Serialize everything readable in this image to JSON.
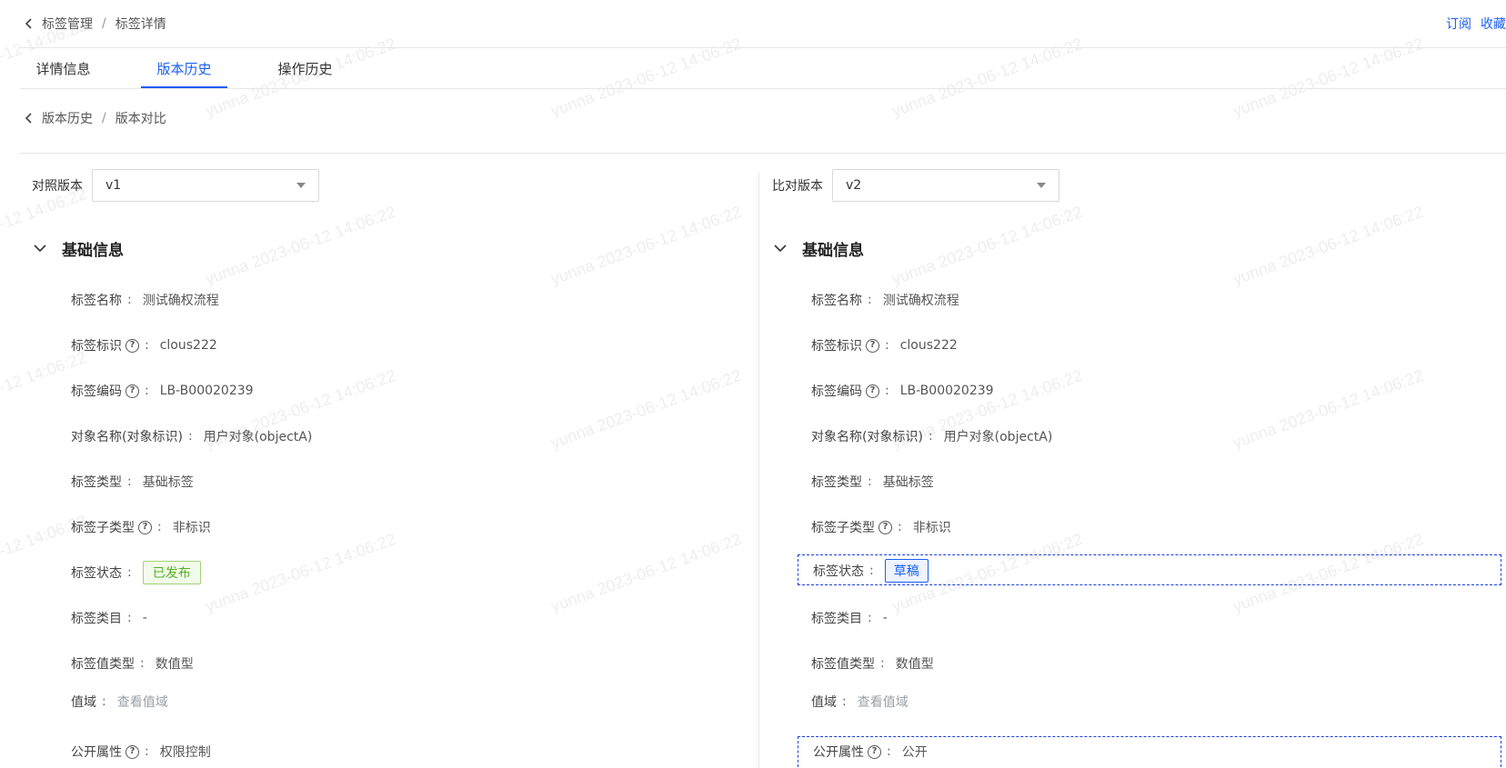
{
  "watermark": "yunna 2023-06-12 14:06:22",
  "header": {
    "breadcrumb": [
      "标签管理",
      "标签详情"
    ],
    "actions": [
      "订阅",
      "收藏"
    ]
  },
  "tabs": [
    {
      "label": "详情信息",
      "active": false
    },
    {
      "label": "版本历史",
      "active": true
    },
    {
      "label": "操作历史",
      "active": false
    }
  ],
  "subcrumb": [
    "版本历史",
    "版本对比"
  ],
  "left": {
    "version_label": "对照版本",
    "version_value": "v1",
    "section_title": "基础信息",
    "fields": {
      "name": {
        "label": "标签名称",
        "value": "测试确权流程"
      },
      "ident": {
        "label": "标签标识",
        "value": "clous222"
      },
      "code": {
        "label": "标签编码",
        "value": "LB-B00020239"
      },
      "object": {
        "label": "对象名称(对象标识)",
        "value": "用户对象(objectA)"
      },
      "type": {
        "label": "标签类型",
        "value": "基础标签"
      },
      "subtype": {
        "label": "标签子类型",
        "value": "非标识"
      },
      "status": {
        "label": "标签状态",
        "value": "已发布"
      },
      "category": {
        "label": "标签类目",
        "value": "-"
      },
      "valtype": {
        "label": "标签值类型",
        "value": "数值型"
      },
      "domain": {
        "label": "值域",
        "value": "查看值域"
      },
      "public": {
        "label": "公开属性",
        "value": "权限控制"
      }
    }
  },
  "right": {
    "version_label": "比对版本",
    "version_value": "v2",
    "section_title": "基础信息",
    "fields": {
      "name": {
        "label": "标签名称",
        "value": "测试确权流程"
      },
      "ident": {
        "label": "标签标识",
        "value": "clous222"
      },
      "code": {
        "label": "标签编码",
        "value": "LB-B00020239"
      },
      "object": {
        "label": "对象名称(对象标识)",
        "value": "用户对象(objectA)"
      },
      "type": {
        "label": "标签类型",
        "value": "基础标签"
      },
      "subtype": {
        "label": "标签子类型",
        "value": "非标识"
      },
      "status": {
        "label": "标签状态",
        "value": "草稿"
      },
      "category": {
        "label": "标签类目",
        "value": "-"
      },
      "valtype": {
        "label": "标签值类型",
        "value": "数值型"
      },
      "domain": {
        "label": "值域",
        "value": "查看值域"
      },
      "public": {
        "label": "公开属性",
        "value": "公开"
      }
    }
  },
  "colors": {
    "accent": "#1a5ff2",
    "published_green": "#58b026",
    "diff_border": "#1a3fdc"
  },
  "icons": {
    "back": "chevron-left-icon",
    "collapse": "chevron-down-icon",
    "help": "question-circle-icon",
    "dropdown": "caret-down-icon"
  }
}
